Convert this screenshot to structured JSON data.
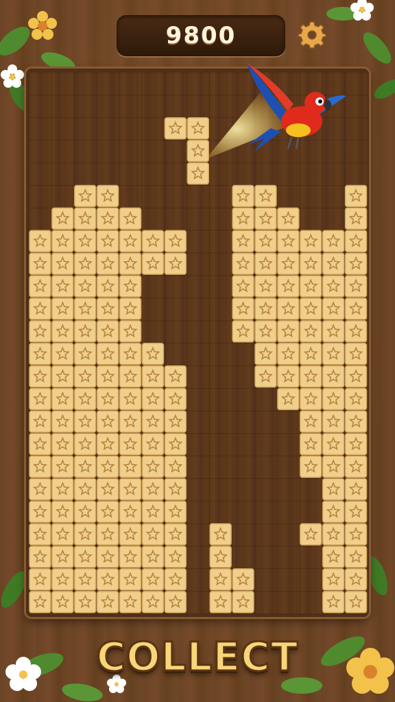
{
  "game": {
    "score": "9800",
    "action_label": "COLLECT",
    "settings_icon": "gear-icon"
  },
  "board": {
    "columns": 15,
    "rows": 24,
    "tile_icon": "star-icon",
    "filled_rows": [
      "...............",
      "...............",
      "...............",
      "...............",
      "...............",
      "...............",
      "...............",
      "...............",
      "...............",
      "..............."
    ]
  },
  "colors": {
    "tile_light": "#f0cf8c",
    "tile_dark": "#d6a95e",
    "board_bg": "#5a361a",
    "collect_text": "#f7d57a"
  }
}
